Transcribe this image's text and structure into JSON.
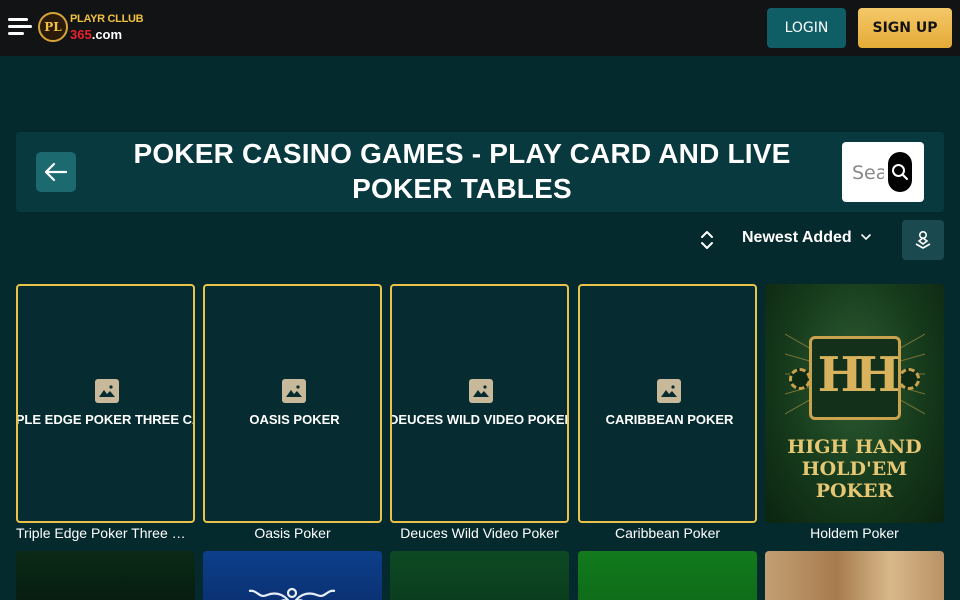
{
  "header": {
    "logo_line1": "PLAYR CLLUB",
    "logo_number": "365",
    "logo_domain": ".com",
    "logo_mark": "PL",
    "login_label": "LOGIN",
    "signup_label": "SIGN UP"
  },
  "page": {
    "title": "POKER CASINO GAMES - PLAY CARD AND LIVE POKER TABLES",
    "search_placeholder": "Search"
  },
  "sort": {
    "selected": "Newest Added"
  },
  "icons": {
    "menu": "hamburger-icon",
    "back": "arrow-left-icon",
    "search": "search-icon",
    "sort": "sort-updown-icon",
    "chevron": "chevron-down-icon",
    "provider": "provider-filter-icon",
    "placeholder": "image-placeholder-icon"
  },
  "colors": {
    "background": "#052a2e",
    "topbar": "#111314",
    "login_button": "#0f5e66",
    "signup_button": "#f0bd55",
    "card_border": "#e8c24a"
  },
  "games": [
    {
      "name": "Triple Edge Poker Three Card",
      "thumb_text": "TRIPLE EDGE POKER THREE CARD"
    },
    {
      "name": "Oasis Poker",
      "thumb_text": "OASIS POKER"
    },
    {
      "name": "Deuces Wild Video Poker",
      "thumb_text": "DEUCES WILD VIDEO POKER"
    },
    {
      "name": "Caribbean Poker",
      "thumb_text": "CARIBBEAN POKER"
    },
    {
      "name": "Holdem Poker",
      "art_line1": "HIGH HAND",
      "art_line2": "HOLD'EM POKER",
      "art_mark": "HH"
    }
  ]
}
